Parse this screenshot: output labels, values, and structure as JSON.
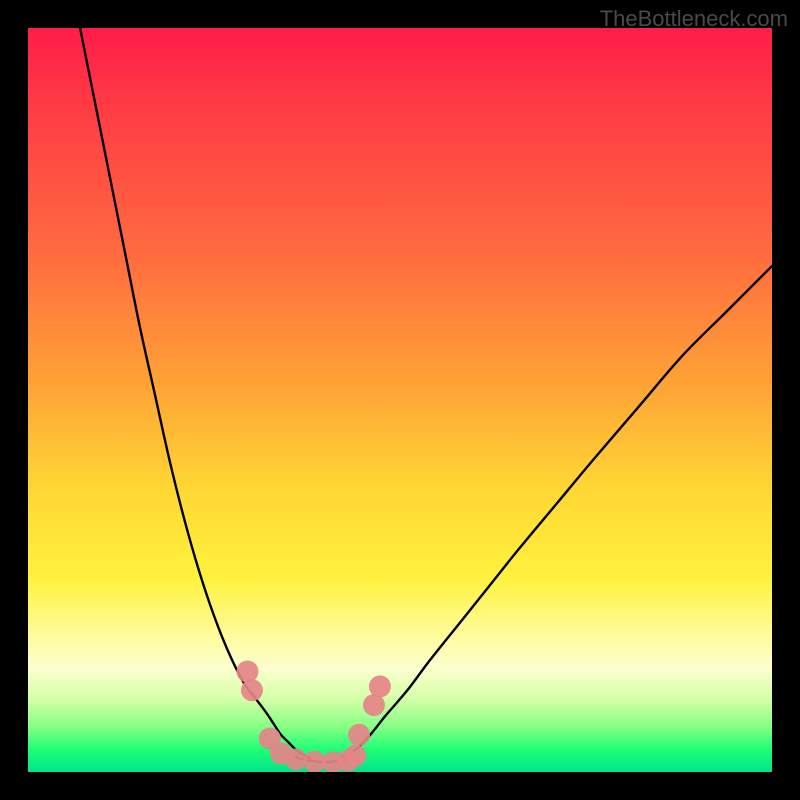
{
  "watermark": "TheBottleneck.com",
  "chart_data": {
    "type": "line",
    "title": "",
    "xlabel": "",
    "ylabel": "",
    "xlim": [
      0,
      100
    ],
    "ylim": [
      0,
      100
    ],
    "grid": false,
    "legend": false,
    "gradient_stops": [
      {
        "pos": 0,
        "color": "#ff1d49"
      },
      {
        "pos": 10,
        "color": "#ff3a45"
      },
      {
        "pos": 30,
        "color": "#ff6a3f"
      },
      {
        "pos": 48,
        "color": "#ffa336"
      },
      {
        "pos": 62,
        "color": "#ffd733"
      },
      {
        "pos": 74,
        "color": "#fff23e"
      },
      {
        "pos": 82,
        "color": "#fffca0"
      },
      {
        "pos": 86,
        "color": "#fcffce"
      },
      {
        "pos": 90,
        "color": "#d7ffa9"
      },
      {
        "pos": 94,
        "color": "#84ff84"
      },
      {
        "pos": 97,
        "color": "#1dff76"
      },
      {
        "pos": 100,
        "color": "#00e589"
      }
    ],
    "series": [
      {
        "name": "left-curve",
        "x": [
          7,
          9,
          11,
          13,
          15,
          17,
          19,
          21,
          23,
          25,
          27,
          29,
          30.5,
          32,
          33,
          34,
          35,
          36,
          37,
          38
        ],
        "y": [
          100,
          90,
          80,
          70,
          60,
          51,
          42,
          34,
          27,
          21,
          16,
          12,
          10,
          8,
          6.5,
          5,
          4,
          3,
          2.3,
          1.8
        ],
        "color": "#000000"
      },
      {
        "name": "right-curve",
        "x": [
          42,
          44,
          46,
          48,
          51,
          54,
          58,
          62,
          66,
          71,
          76,
          82,
          88,
          94,
          100
        ],
        "y": [
          1.8,
          3,
          5,
          7.5,
          11,
          15,
          20,
          25,
          30,
          36,
          42,
          49,
          56,
          62,
          68
        ],
        "color": "#000000"
      },
      {
        "name": "bottom-flat",
        "x": [
          36,
          37,
          38,
          39,
          40,
          41,
          42,
          43,
          44
        ],
        "y": [
          2.0,
          1.7,
          1.5,
          1.4,
          1.3,
          1.4,
          1.5,
          1.7,
          2.0
        ],
        "color": "#000000"
      }
    ],
    "data_points": [
      {
        "x": 29.5,
        "y": 13.5,
        "r": 11
      },
      {
        "x": 30.1,
        "y": 11.0,
        "r": 11
      },
      {
        "x": 32.5,
        "y": 4.5,
        "r": 11
      },
      {
        "x": 34.0,
        "y": 2.5,
        "r": 11
      },
      {
        "x": 36.0,
        "y": 1.7,
        "r": 11
      },
      {
        "x": 38.5,
        "y": 1.4,
        "r": 11
      },
      {
        "x": 41.0,
        "y": 1.3,
        "r": 11
      },
      {
        "x": 43.0,
        "y": 1.5,
        "r": 11
      },
      {
        "x": 44.0,
        "y": 2.2,
        "r": 11
      },
      {
        "x": 44.5,
        "y": 5.0,
        "r": 11
      },
      {
        "x": 46.5,
        "y": 9.0,
        "r": 11
      },
      {
        "x": 47.3,
        "y": 11.5,
        "r": 11
      }
    ],
    "data_points_color": "#e58488"
  }
}
